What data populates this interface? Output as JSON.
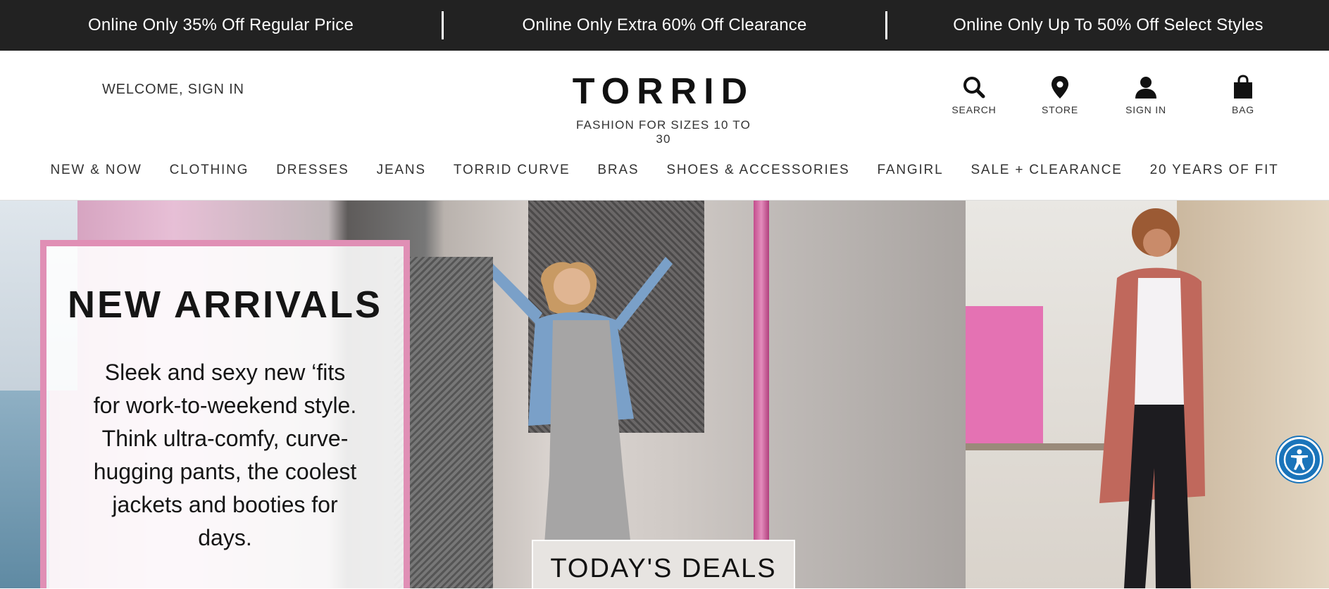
{
  "promo": {
    "items": [
      "Online Only 35% Off Regular Price",
      "Online Only Extra 60% Off Clearance",
      "Online Only Up To 50% Off Select Styles"
    ]
  },
  "header": {
    "welcome": "WELCOME, SIGN IN",
    "logo": {
      "word": "TORRID",
      "tagline": "FASHION FOR SIZES 10 TO 30"
    },
    "utilities": [
      {
        "label": "SEARCH",
        "icon": "search-icon"
      },
      {
        "label": "STORE",
        "icon": "location-pin-icon"
      },
      {
        "label": "SIGN IN",
        "icon": "user-icon"
      },
      {
        "label": "BAG",
        "icon": "shopping-bag-icon"
      }
    ]
  },
  "nav": {
    "items": [
      "NEW & NOW",
      "CLOTHING",
      "DRESSES",
      "JEANS",
      "TORRID CURVE",
      "BRAS",
      "SHOES & ACCESSORIES",
      "FANGIRL",
      "SALE + CLEARANCE",
      "20 YEARS OF FIT"
    ]
  },
  "hero": {
    "title": "NEW ARRIVALS",
    "body": "Sleek and sexy new ‘fits for work-to-weekend style. Think ultra-comfy, curve-hugging pants, the coolest jackets and booties for days.",
    "cta": "TODAY'S DEALS"
  },
  "colors": {
    "promo_bg": "#222222",
    "card_border": "#e08fb5",
    "accessibility": "#1a74ba"
  }
}
